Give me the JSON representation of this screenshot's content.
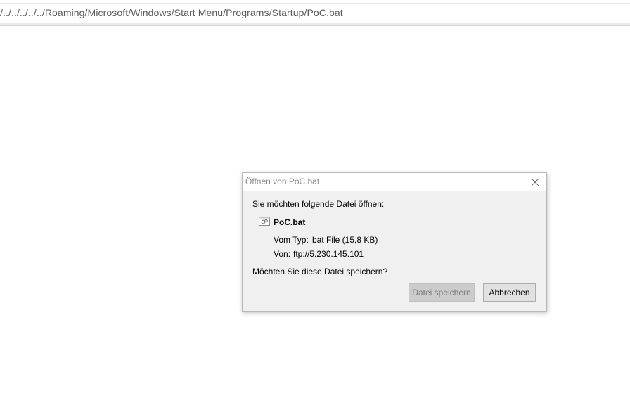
{
  "address_bar": {
    "url": "/../../../../../Roaming/Microsoft/Windows/Start Menu/Programs/Startup/PoC.bat"
  },
  "dialog": {
    "title": "Öffnen von PoC.bat",
    "intro": "Sie möchten folgende Datei öffnen:",
    "file_name": "PoC.bat",
    "file_icon": "batch-file-icon",
    "type_label": "Vom Typ:",
    "type_value": "bat File (15,8 KB)",
    "from_label": "Von:",
    "from_value": "ftp://5.230.145.101",
    "question": "Möchten Sie diese Datei speichern?",
    "save_label": "Datei speichern",
    "save_disabled": true,
    "cancel_label": "Abbrechen",
    "close_icon": "close-icon"
  }
}
